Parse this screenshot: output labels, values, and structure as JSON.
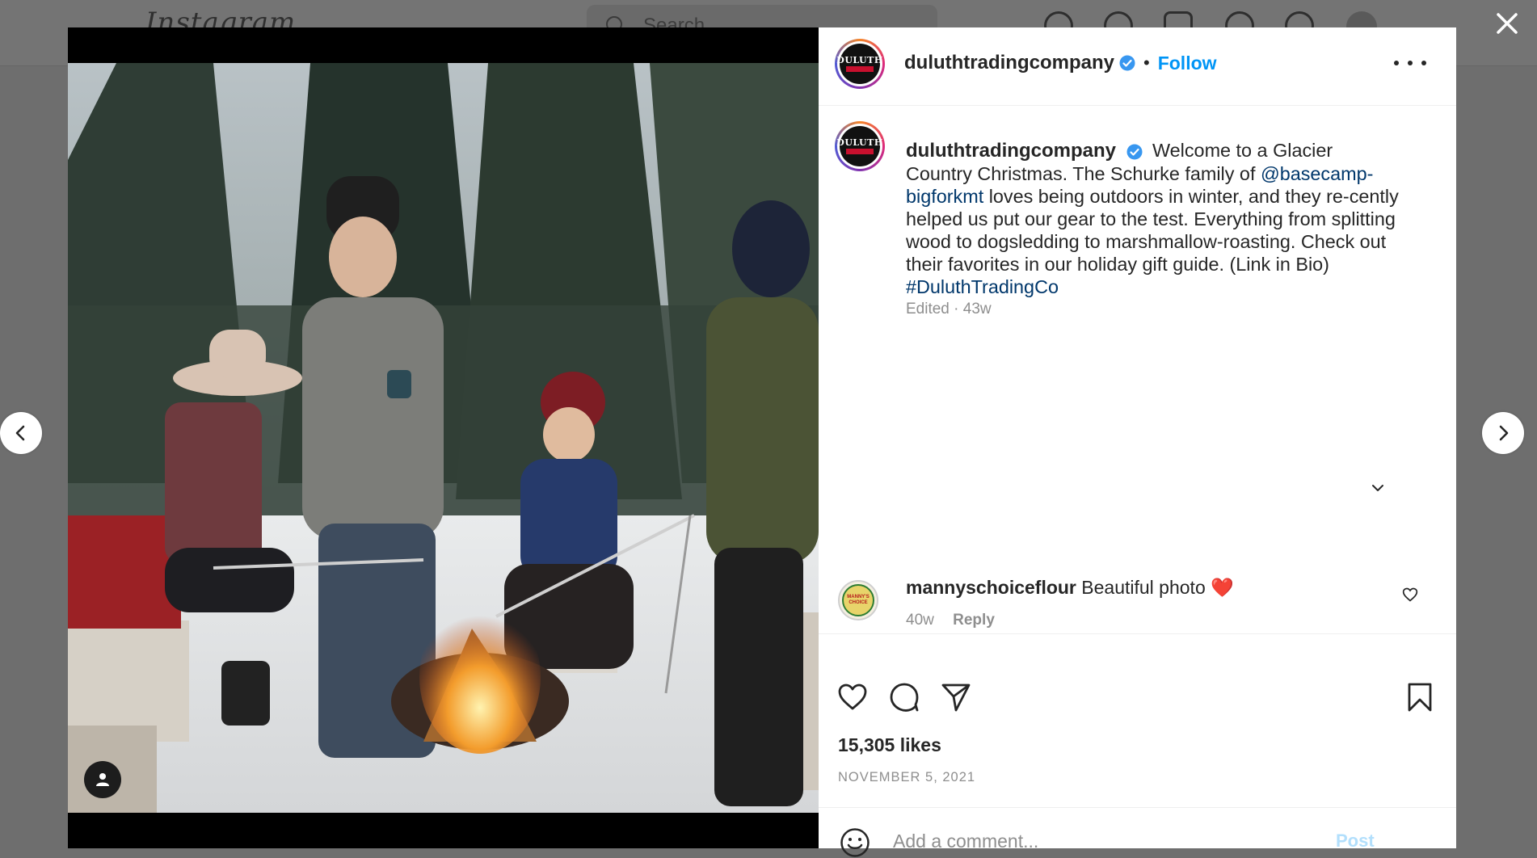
{
  "background": {
    "logo": "Instagram",
    "search_placeholder": "Search"
  },
  "post": {
    "username": "duluthtradingcompany",
    "follow_label": "Follow",
    "separator": "•",
    "caption_intro": "Welcome to a Glacier Country Christmas. The Schurke family of ",
    "caption_mention": "@basecamp-bigforkmt",
    "caption_body": " loves being outdoors in winter, and they re-cently helped us put our gear to the test. Everything from splitting wood to dogsledding to marshmallow-roasting. Check out their favorites in our holiday gift guide. (Link in Bio) ",
    "caption_hashtag": "#DuluthTradingCo",
    "caption_meta": "Edited · 43w",
    "avatar_text": "DULUTH"
  },
  "comments": [
    {
      "username": "mannyschoiceflour",
      "text": "Beautiful photo ❤️",
      "age": "40w",
      "reply_label": "Reply",
      "avatar_text": "MANNY'S CHOICE"
    }
  ],
  "stats": {
    "likes": "15,305 likes",
    "date": "NOVEMBER 5, 2021"
  },
  "composer": {
    "placeholder": "Add a comment...",
    "post_label": "Post"
  },
  "icons": {
    "close": "close-icon",
    "prev": "chevron-left-icon",
    "next": "chevron-right-icon",
    "more": "more-options-icon",
    "like": "heart-icon",
    "comment": "comment-icon",
    "share": "share-icon",
    "save": "bookmark-icon",
    "emoji": "emoji-icon",
    "tag": "user-tag-icon",
    "verified": "verified-badge-icon",
    "expand": "chevron-down-icon"
  },
  "colors": {
    "accent": "#0095f6",
    "link": "#00376b",
    "muted": "#8e8e8e",
    "text": "#262626",
    "overlay": "#6e6e6e"
  }
}
